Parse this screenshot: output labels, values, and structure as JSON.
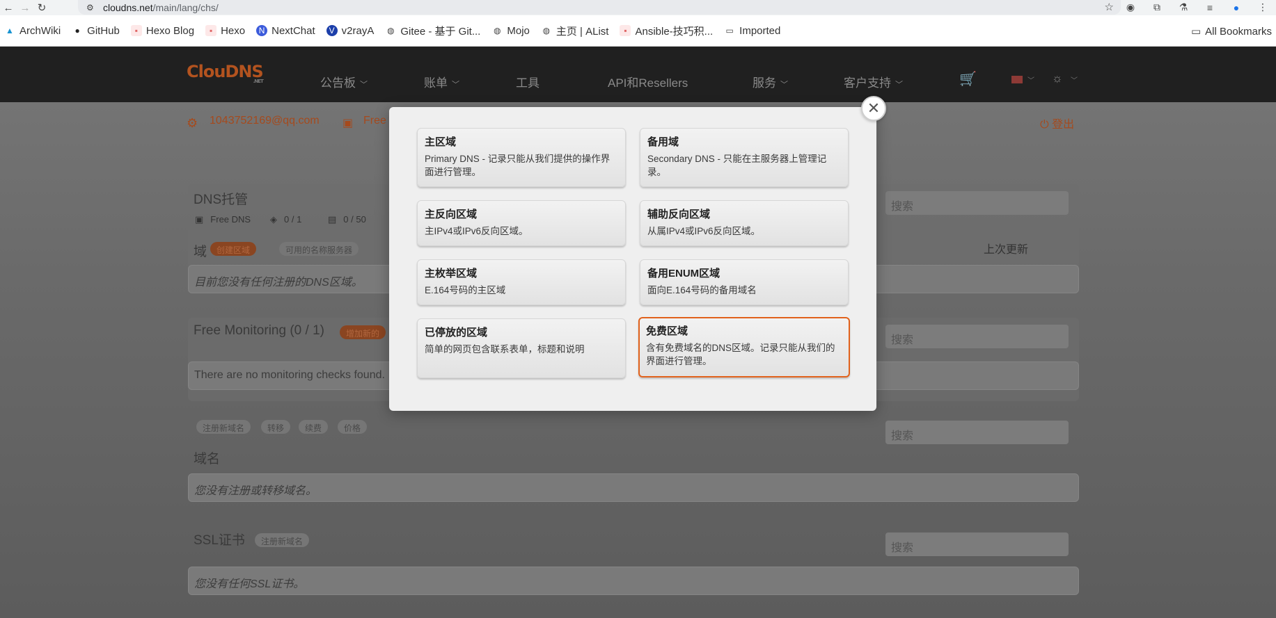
{
  "browser": {
    "url_host": "cloudns.net",
    "url_path": "/main/lang/chs/",
    "bookmarks": [
      {
        "label": "ArchWiki",
        "color": "#1793d1"
      },
      {
        "label": "GitHub",
        "color": "#222222"
      },
      {
        "label": "Hexo Blog",
        "color": "#e06666"
      },
      {
        "label": "Hexo",
        "color": "#e06666"
      },
      {
        "label": "NextChat",
        "color": "#3b5bdb"
      },
      {
        "label": "v2rayA",
        "color": "#1c3faa"
      },
      {
        "label": "Gitee - 基于 Git...",
        "color": "#444444"
      },
      {
        "label": "Mojo",
        "color": "#444444"
      },
      {
        "label": "主页 | AList",
        "color": "#444444"
      },
      {
        "label": "Ansible-技巧积...",
        "color": "#e06666"
      },
      {
        "label": "Imported",
        "color": "#444444"
      }
    ],
    "all_bookmarks": "All Bookmarks"
  },
  "site": {
    "logo": "ClouDNS",
    "logo_sub": ".NET",
    "nav": [
      {
        "label": "公告板",
        "dropdown": true
      },
      {
        "label": "账单",
        "dropdown": true
      },
      {
        "label": "工具",
        "dropdown": false
      },
      {
        "label": "API和Resellers",
        "dropdown": false
      },
      {
        "label": "服务",
        "dropdown": true
      },
      {
        "label": "客户支持",
        "dropdown": true
      }
    ],
    "user_email": "1043752169@qq.com",
    "plan": "Free",
    "logout": "登出"
  },
  "dns_section": {
    "title": "DNS托管",
    "plan_label": "Free DNS",
    "zones_count": "0 / 1",
    "records_count": "0 / 50",
    "domains_label": "域",
    "create_zone": "创建区域",
    "available_ns": "可用的名称服务器",
    "last_update": "上次更新",
    "empty": "目前您没有任何注册的DNS区域。",
    "search_placeholder": "搜索"
  },
  "monitoring_section": {
    "title": "Free Monitoring (0 / 1)",
    "add_new": "增加新的",
    "empty": "There are no monitoring checks found.",
    "search_placeholder": "搜索"
  },
  "domains_section": {
    "tabs": [
      "注册新域名",
      "转移",
      "续费",
      "价格"
    ],
    "title": "域名",
    "empty": "您没有注册或转移域名。",
    "search_placeholder": "搜索"
  },
  "ssl_section": {
    "title": "SSL证书",
    "register": "注册新域名",
    "empty": "您没有任何SSL证书。",
    "search_placeholder": "搜索"
  },
  "modal": {
    "options": [
      {
        "title": "主区域",
        "desc": "Primary DNS - 记录只能从我们提供的操作界面进行管理。"
      },
      {
        "title": "备用域",
        "desc": "Secondary DNS - 只能在主服务器上管理记录。"
      },
      {
        "title": "主反向区域",
        "desc": "主IPv4或IPv6反向区域。"
      },
      {
        "title": "辅助反向区域",
        "desc": "从属IPv4或IPv6反向区域。"
      },
      {
        "title": "主枚举区域",
        "desc": "E.164号码的主区域"
      },
      {
        "title": "备用ENUM区域",
        "desc": "面向E.164号码的备用域名"
      },
      {
        "title": "已停放的区域",
        "desc": "简单的网页包含联系表单，标题和说明"
      },
      {
        "title": "免费区域",
        "desc": "含有免费域名的DNS区域。记录只能从我们的界面进行管理。"
      }
    ],
    "selected_index": 7,
    "accent_color": "#e1621c"
  }
}
